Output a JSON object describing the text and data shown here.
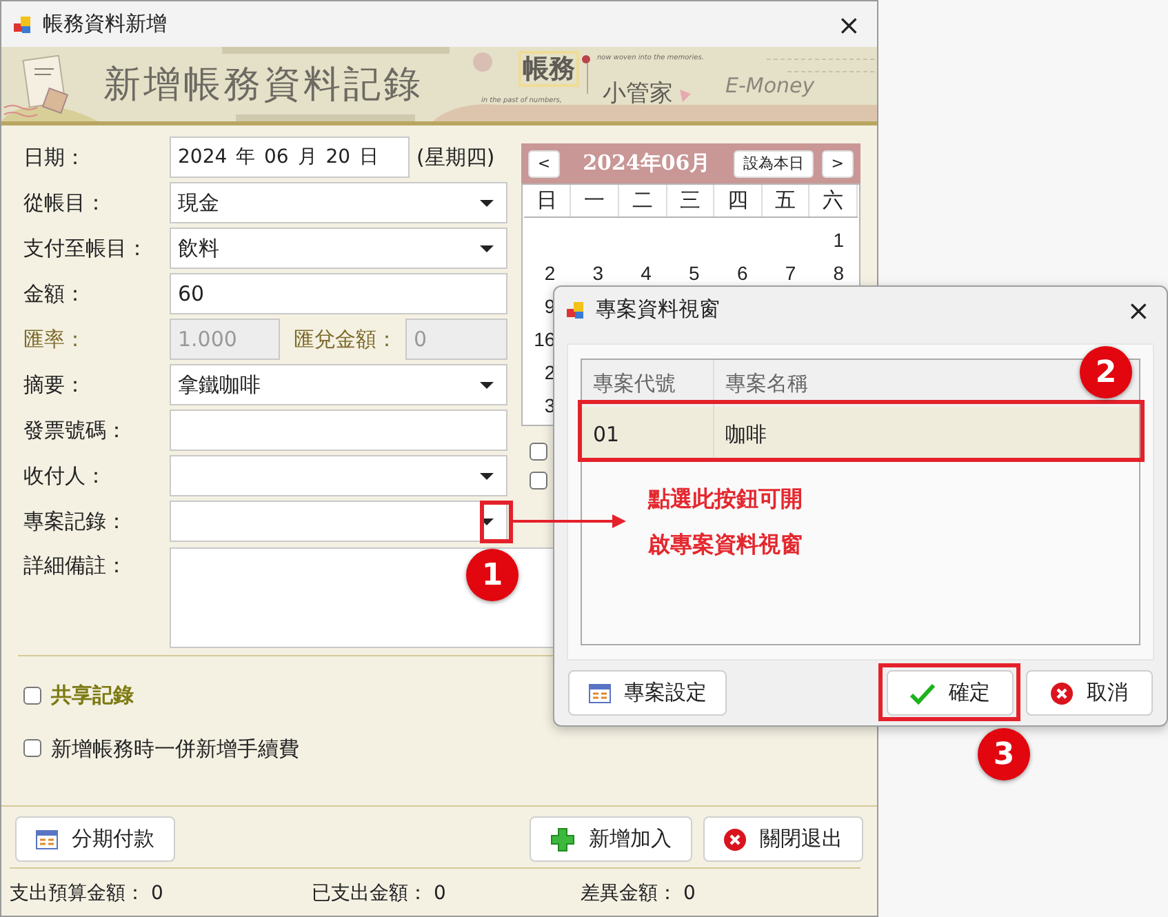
{
  "window": {
    "title": "帳務資料新增",
    "close": "×"
  },
  "banner": {
    "title": "新增帳務資料記錄",
    "logo_main": "帳務",
    "logo_sub": "小管家",
    "tagline_1": "in the past of numbers,",
    "tagline_2": "now woven into the memories.",
    "brand": "E-Money"
  },
  "fields": [
    {
      "kind": "date",
      "label": "日期：",
      "value": "2024 年 06 月 20 日",
      "suffix": "(星期四)"
    },
    {
      "kind": "select",
      "label": "從帳目：",
      "value": "現金"
    },
    {
      "kind": "select",
      "label": "支付至帳目：",
      "value": "飲料"
    },
    {
      "kind": "text",
      "label": "金額：",
      "value": "60"
    },
    {
      "kind": "rate",
      "label": "匯率：",
      "value": "1.000",
      "label_2": "匯兌金額：",
      "value_2": "0",
      "disabled": true
    },
    {
      "kind": "select",
      "label": "摘要：",
      "value": "拿鐵咖啡"
    },
    {
      "kind": "text",
      "label": "發票號碼："
    },
    {
      "kind": "select",
      "label": "收付人："
    },
    {
      "kind": "select",
      "label": "專案記錄："
    },
    {
      "kind": "textarea",
      "label": "詳細備註："
    }
  ],
  "calendar": {
    "prev": "<",
    "title": "2024年06月",
    "today_button": "設為本日",
    "next": ">",
    "weekdays": [
      "日",
      "一",
      "二",
      "三",
      "四",
      "五",
      "六"
    ],
    "weeks": [
      [
        "1"
      ],
      [
        "2",
        "3",
        "4",
        "5",
        "6",
        "7",
        "8"
      ],
      [
        "9"
      ],
      [
        "16"
      ],
      [
        "2"
      ],
      [
        "3"
      ]
    ],
    "options": [
      {
        "checked": false
      },
      {
        "checked": false
      }
    ]
  },
  "options": [
    {
      "kind": "shared",
      "label": "共享記錄",
      "checked": false
    },
    {
      "kind": "plain",
      "label": "新增帳務時一併新增手續費",
      "checked": false
    }
  ],
  "buttons": [
    {
      "kind": "table",
      "label": "分期付款"
    },
    {
      "kind": "add",
      "label": "新增加入"
    },
    {
      "kind": "exit",
      "label": "關閉退出"
    }
  ],
  "status_bar": [
    {
      "label": "支出預算金額：",
      "value": "0"
    },
    {
      "label": "已支出金額：",
      "value": "0"
    },
    {
      "label": "差異金額：",
      "value": "0"
    }
  ],
  "dialog": {
    "title": "專案資料視窗",
    "close": "×",
    "columns": [
      "專案代號",
      "專案名稱"
    ],
    "rows": [
      {
        "cells": [
          "01",
          "咖啡"
        ],
        "selected": true
      }
    ],
    "buttons": [
      {
        "kind": "table",
        "label": "專案設定"
      },
      {
        "kind": "ok",
        "label": "確定"
      },
      {
        "kind": "exit",
        "label": "取消"
      }
    ]
  },
  "annotations": {
    "callouts": [
      "1",
      "2",
      "3"
    ],
    "note": "點選此按鈕可開啟專案資料視窗"
  }
}
